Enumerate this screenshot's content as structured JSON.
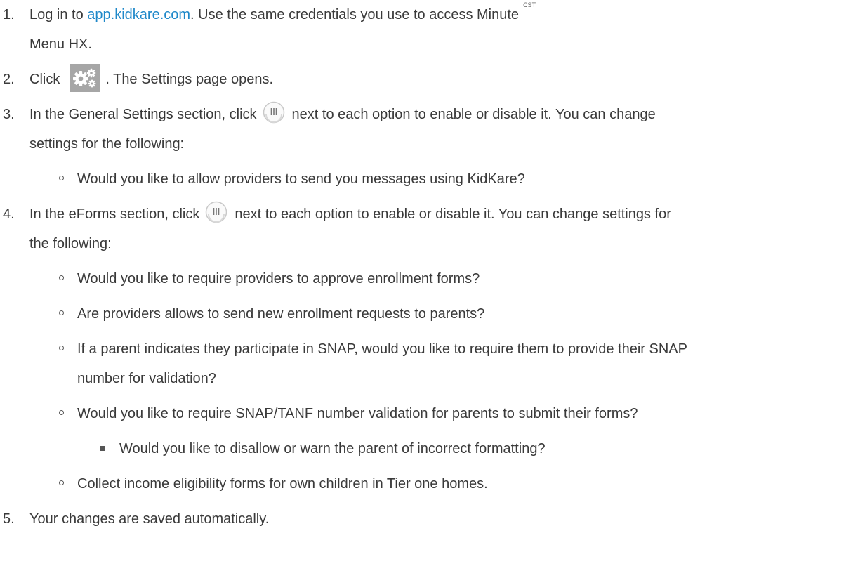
{
  "steps": [
    {
      "num": "1.",
      "text_before": "Log in to ",
      "link": "app.kidkare.com",
      "text_after": ". Use the same credentials you use to access Minute",
      "superscript": "CST",
      "text_line2": "Menu HX."
    },
    {
      "num": "2.",
      "text_before": "Click",
      "icon": "settings-gears-icon",
      "text_after": ". The Settings page opens."
    },
    {
      "num": "3.",
      "text_before": "In the ",
      "bold": "General Settings",
      "text_mid": " section, click",
      "icon": "toggle-icon",
      "text_after": "next to each option to enable or disable it. You can change",
      "text_line2": "settings for the following:",
      "items": [
        "Would you like to allow providers to send you messages using KidKare?"
      ]
    },
    {
      "num": "4.",
      "text_before": "In the ",
      "bold": "eForms",
      "text_mid": " section, click",
      "icon": "toggle-icon",
      "text_after": "next to each option to enable or disable it. You can change settings for",
      "text_line2": "the following:",
      "items": [
        "Would you like to require providers to approve enrollment forms?",
        "Are providers allows to send new enrollment requests to parents?",
        "If a parent indicates they participate in SNAP, would you like to require them to provide their SNAP",
        "number for validation?",
        "Would you like to require SNAP/TANF number validation for parents to submit their forms?",
        "Would you like to disallow or warn the parent of incorrect formatting?",
        "Collect income eligibility forms for own children in Tier one homes."
      ]
    },
    {
      "num": "5.",
      "text_before": "Your changes are saved automatically."
    }
  ]
}
